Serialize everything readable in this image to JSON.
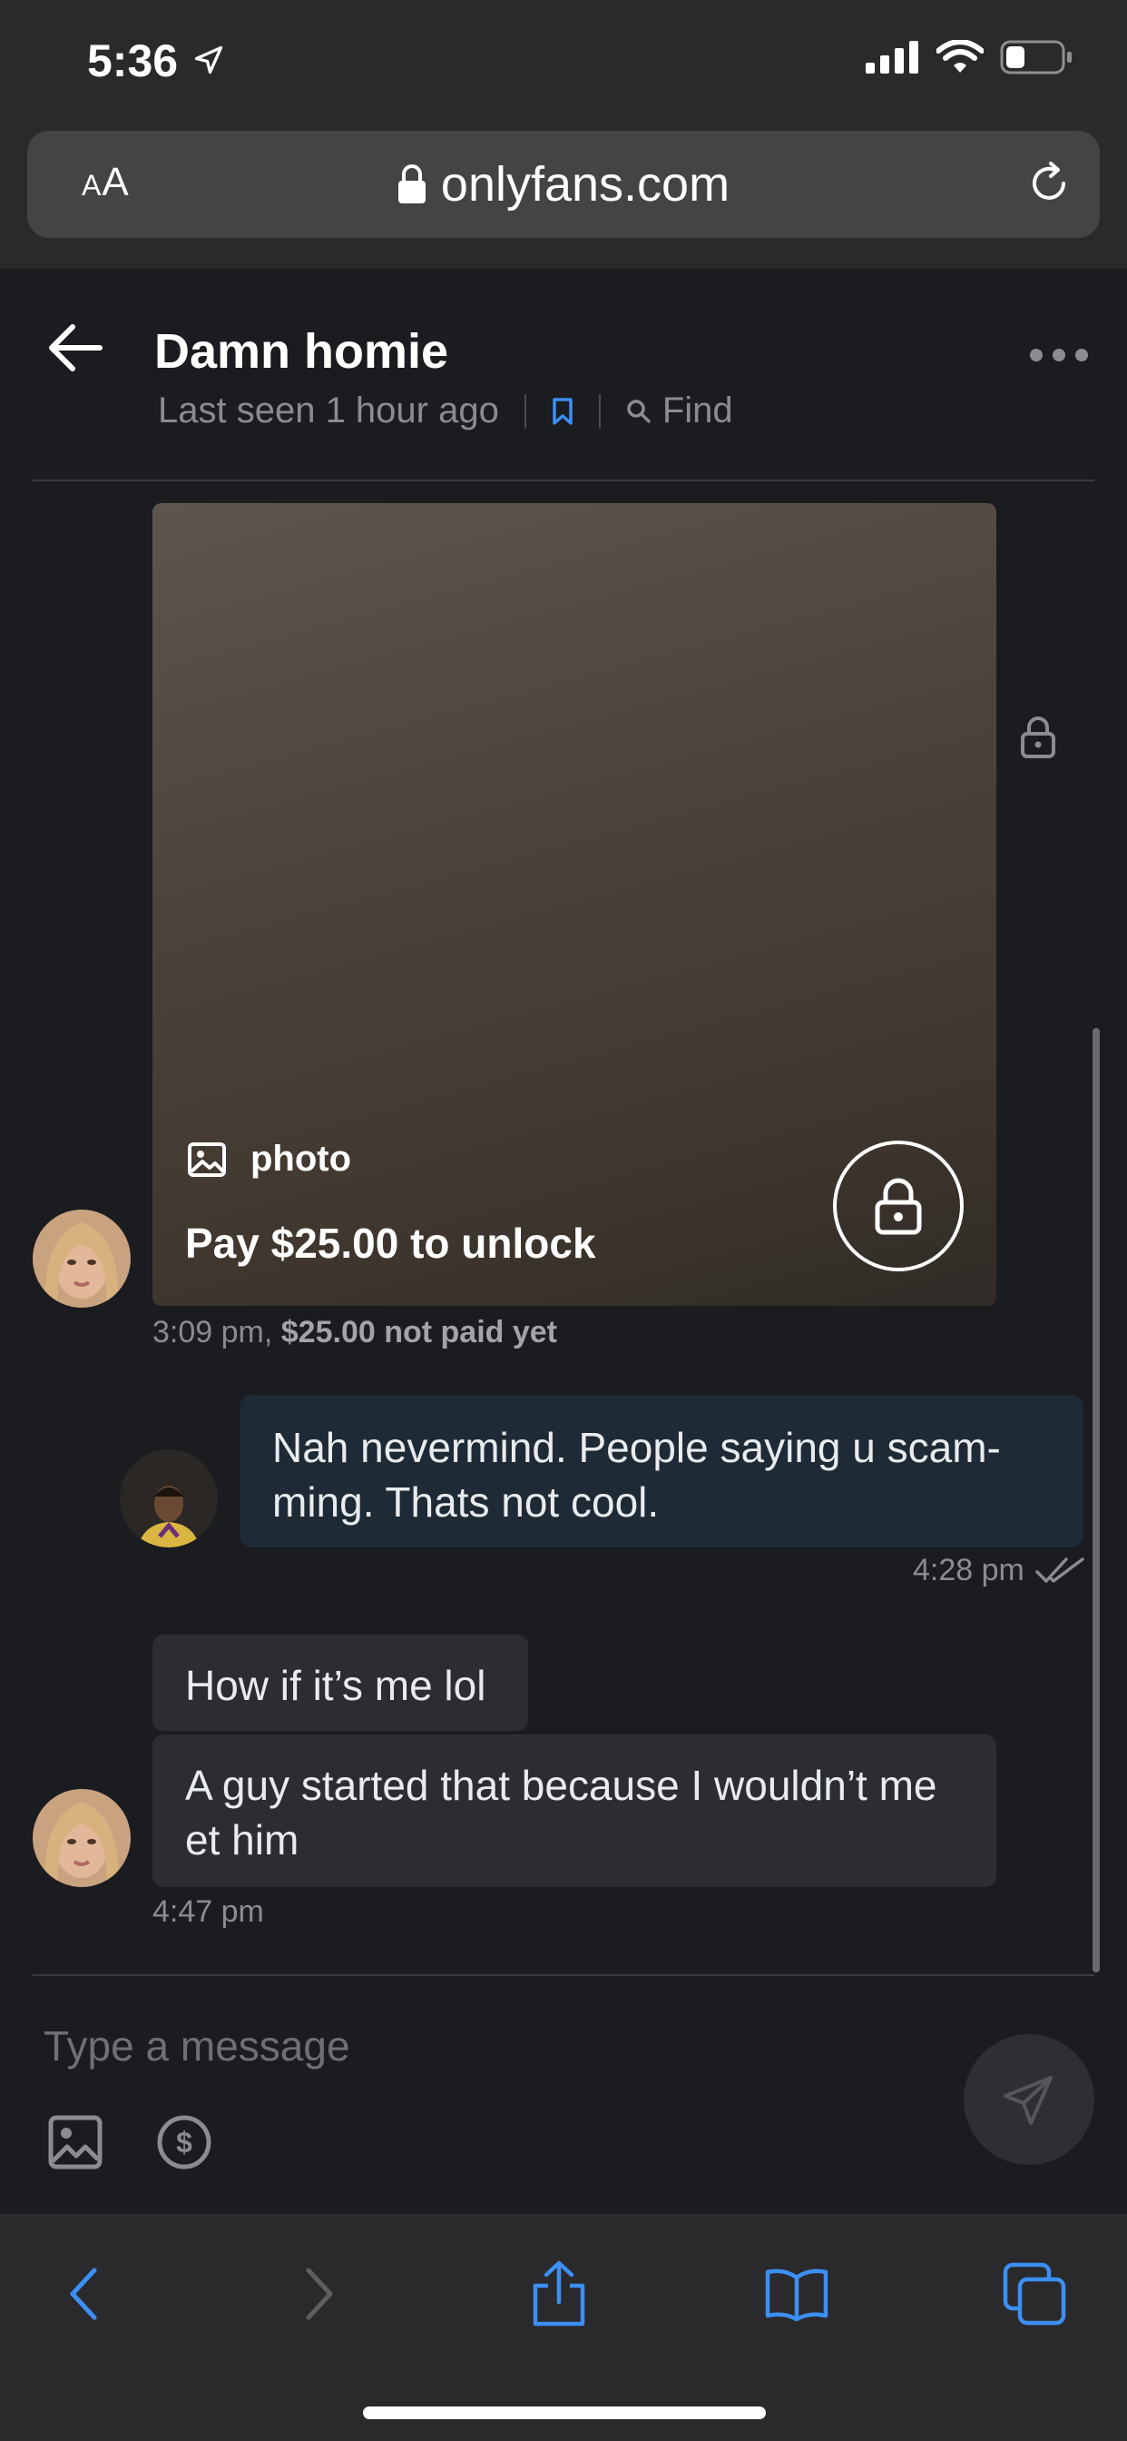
{
  "status_bar": {
    "time": "5:36"
  },
  "browser": {
    "text_size_label": "AA",
    "host": "onlyfans.com"
  },
  "chat": {
    "title": "Damn homie",
    "last_seen": "Last seen 1 hour ago",
    "find_label": "Find"
  },
  "messages": {
    "locked_photo": {
      "type_label": "photo",
      "pay_label": "Pay $25.00 to unlock",
      "time": "3:09 pm,",
      "paid_status": "$25.00 not paid yet"
    },
    "outgoing": {
      "text": "Nah nevermind. People saying u scam-ming. Thats not cool.",
      "time": "4:28 pm"
    },
    "incoming_1": {
      "text": "How if it’s me lol"
    },
    "incoming_2": {
      "text": "A guy started that because I wouldn’t me et him",
      "time": "4:47 pm"
    }
  },
  "composer": {
    "placeholder": "Type a message"
  },
  "colors": {
    "background": "#1b1c1f",
    "accent_blue": "#3b8ff5",
    "outgoing_bubble": "#1e2a35",
    "incoming_bubble": "#2c2d31"
  }
}
